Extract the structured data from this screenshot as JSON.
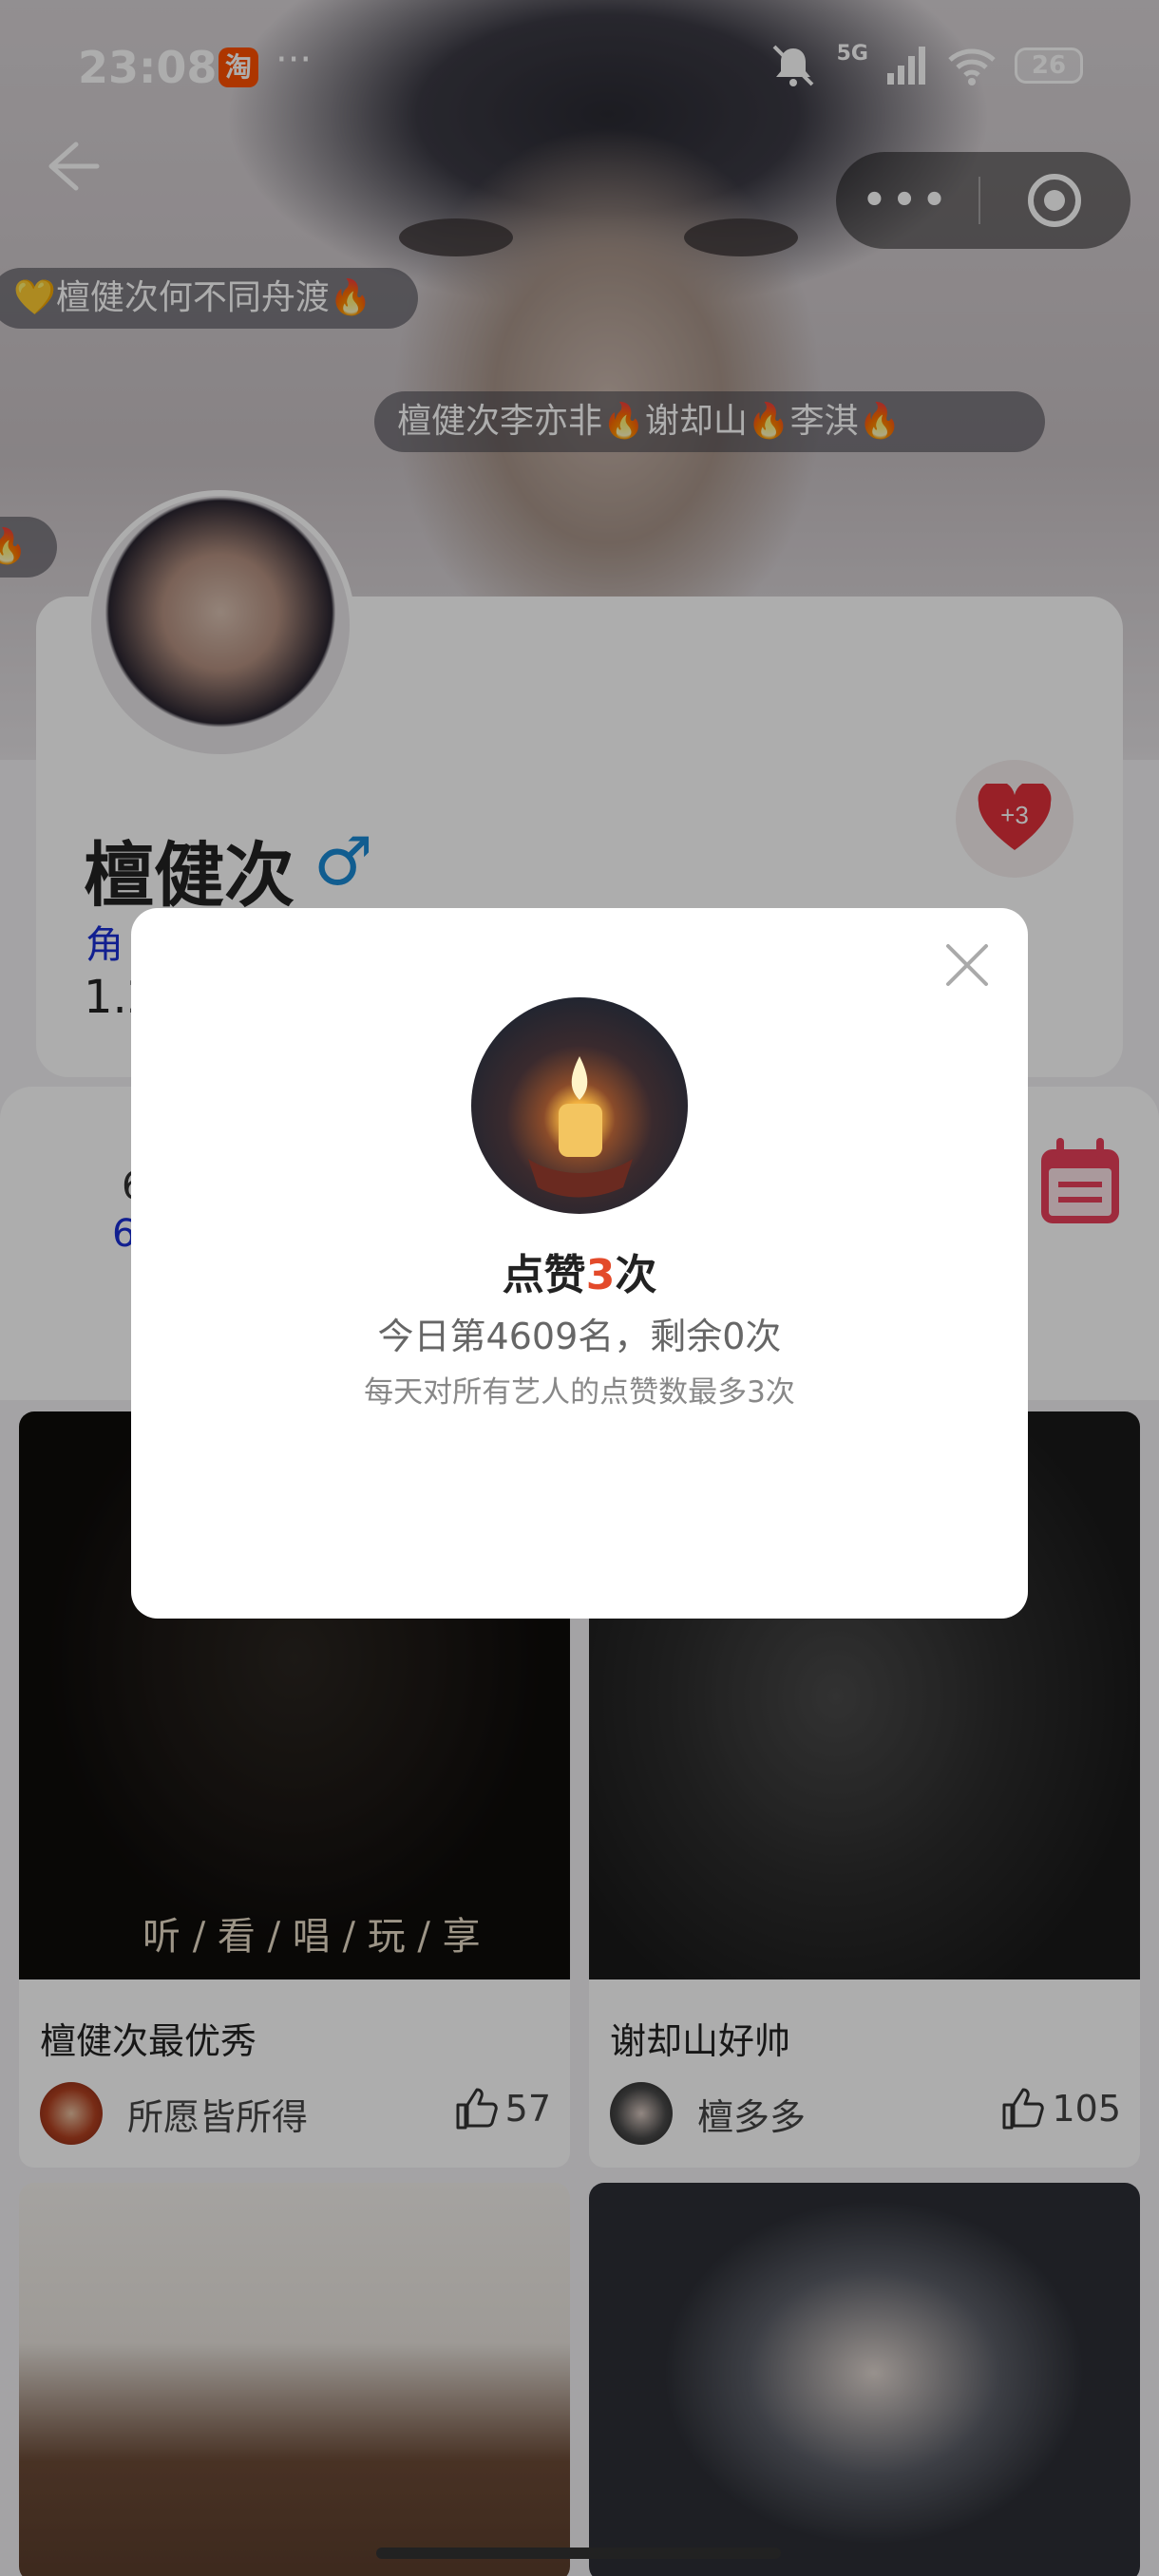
{
  "status_bar": {
    "time": "23:08",
    "app_badge": "淘",
    "more": "···",
    "network": "5G",
    "battery": "26"
  },
  "danmu": [
    "💛檀健次何不同舟渡🔥",
    "檀健次李亦非🔥谢却山🔥李淇🔥",
    "🔥"
  ],
  "capsule": {
    "more_label": "•••"
  },
  "profile": {
    "name": "檀健次",
    "gender_symbol": "♂",
    "role_prefix": "角",
    "fans_prefix": "1.2",
    "heart_badge": "+3"
  },
  "card2": {
    "line1": "6",
    "line2": "6"
  },
  "popup": {
    "title_prefix": "点赞",
    "title_count": "3",
    "title_suffix": "次",
    "rank_text": "今日第4609名，剩余0次",
    "note": "每天对所有艺人的点赞数最多3次"
  },
  "feed": [
    {
      "caption": "檀健次最优秀",
      "user": "所愿皆所得",
      "likes": "57",
      "overlay_text": "听 / 看 / 唱 / 玩 / 享"
    },
    {
      "caption": "谢却山好帅",
      "user": "檀多多",
      "likes": "105"
    },
    {
      "caption": "",
      "user": "",
      "likes": ""
    },
    {
      "caption": "",
      "user": "",
      "likes": ""
    }
  ]
}
